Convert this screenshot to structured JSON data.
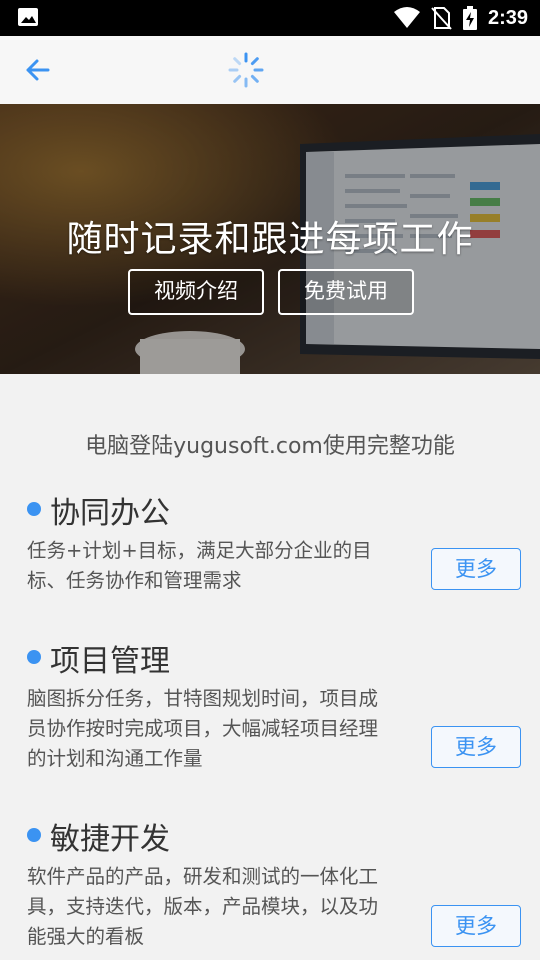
{
  "status_bar": {
    "time": "2:39",
    "icons": [
      "image-icon",
      "wifi-icon",
      "no-sim-icon",
      "battery-charging-icon"
    ]
  },
  "app_bar": {
    "back_icon": "arrow-left-icon",
    "loading_icon": "spinner-icon"
  },
  "hero": {
    "title": "随时记录和跟进每项工作",
    "video_button": "视频介绍",
    "trial_button": "免费试用"
  },
  "subtitle": "电脑登陆yugusoft.com使用完整功能",
  "features": [
    {
      "title": "协同办公",
      "desc_lines": [
        "任务+计划+目标，满足大部分企业的目",
        "标、任务协作和管理需求"
      ],
      "more": "更多"
    },
    {
      "title": "项目管理",
      "desc_lines": [
        "脑图拆分任务，甘特图规划时间，项目成",
        "员协作按时完成项目，大幅减轻项目经理",
        "的计划和沟通工作量"
      ],
      "more": "更多"
    },
    {
      "title": "敏捷开发",
      "desc_lines": [
        "软件产品的产品，研发和测试的一体化工",
        "具，支持迭代，版本，产品模块，以及功",
        "能强大的看板"
      ],
      "more": "更多"
    }
  ],
  "colors": {
    "accent": "#3b93f2",
    "background": "#f2f2f2",
    "statusbar": "#000000"
  }
}
